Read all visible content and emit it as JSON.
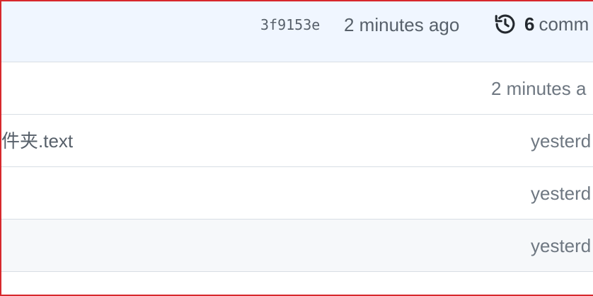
{
  "latest_commit": {
    "sha": "3f9153e",
    "time_ago": "2 minutes ago",
    "history_icon": "history-icon",
    "commit_count": "6",
    "commit_label": "comm"
  },
  "files": [
    {
      "name": "",
      "time": "2 minutes a"
    },
    {
      "name": "件夹.text",
      "time": "yesterd"
    },
    {
      "name": "",
      "time": "yesterd"
    },
    {
      "name": "",
      "time": "yesterd"
    }
  ],
  "colors": {
    "header_bg": "#f0f6ff",
    "frame_border": "#d7282c",
    "muted_text": "#57606a",
    "row_divider": "#d8dee4"
  }
}
